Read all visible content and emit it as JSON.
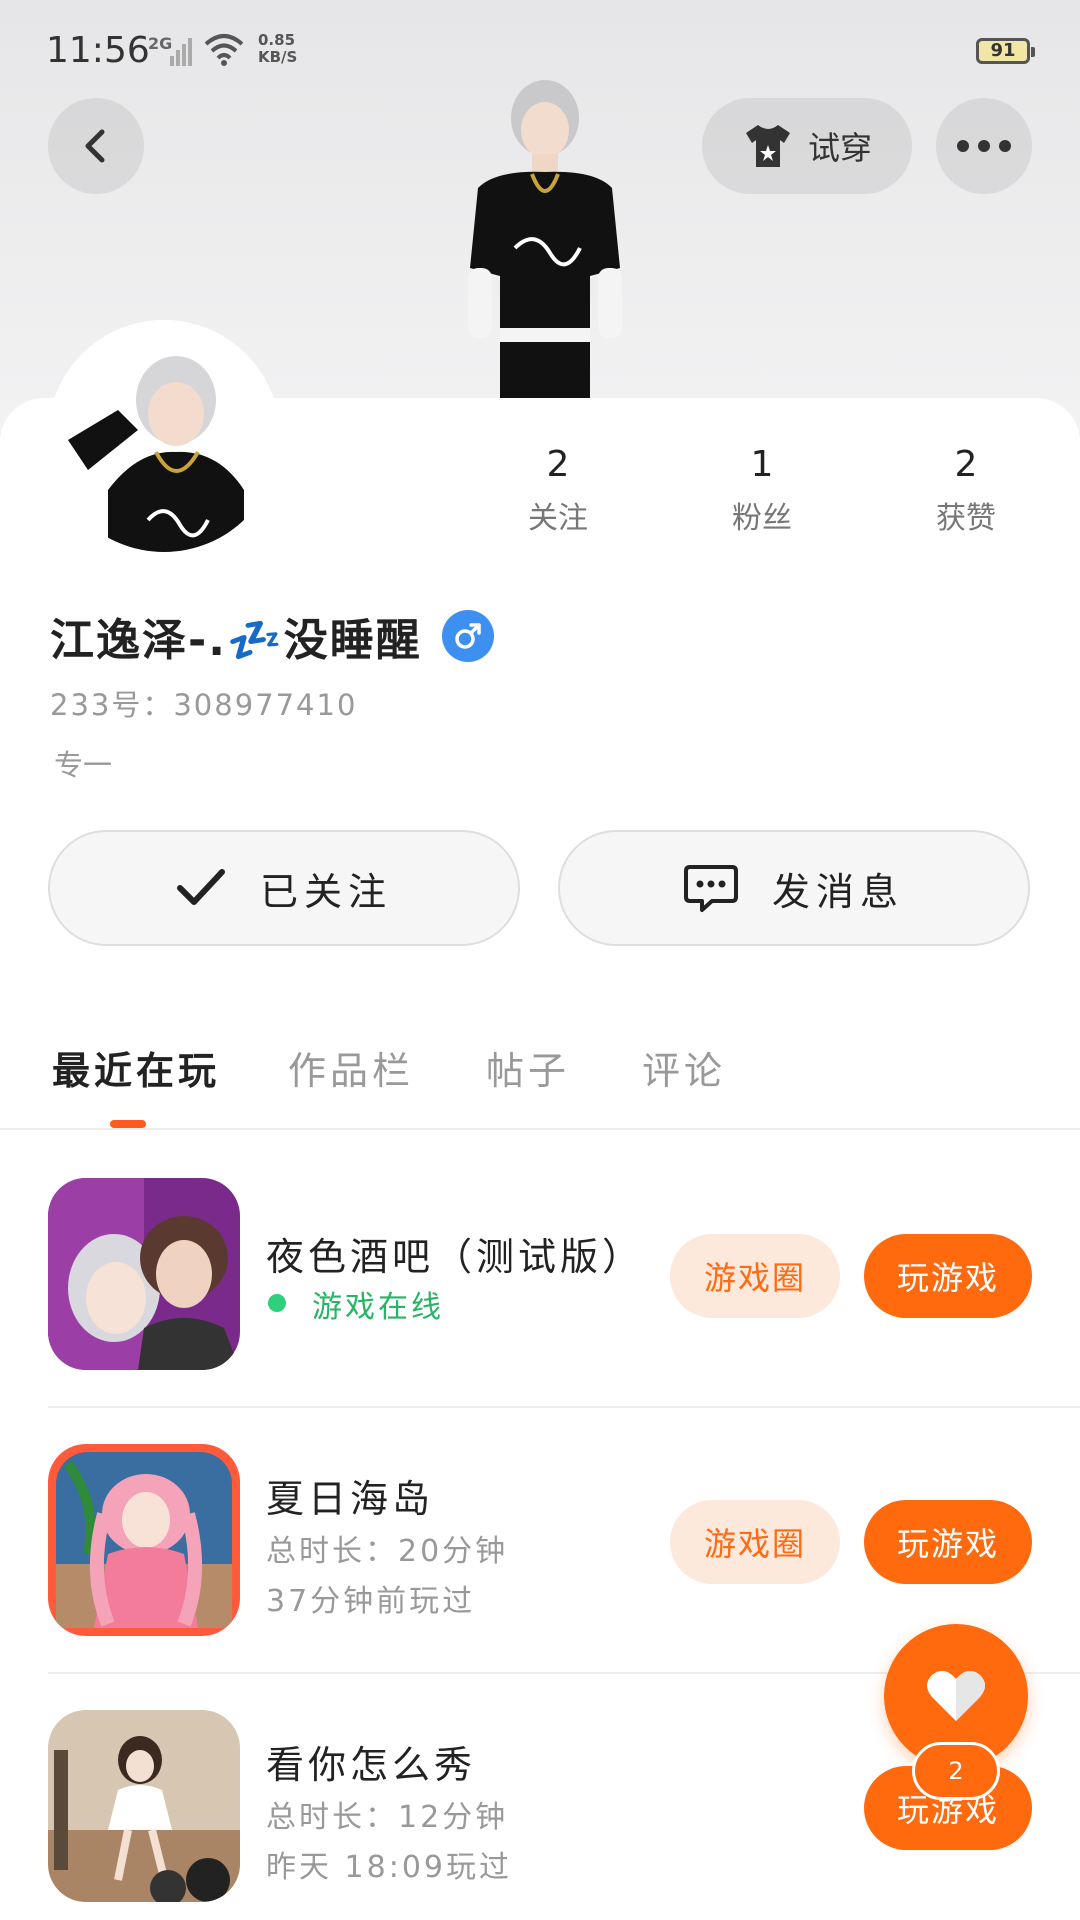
{
  "status_bar": {
    "time": "11:56",
    "network": "2G",
    "speed_value": "0.85",
    "speed_unit": "KB/S",
    "battery": "91"
  },
  "header": {
    "back_icon": "chevron-left-icon",
    "tryon_label": "试穿",
    "tryon_icon": "tshirt-icon",
    "more_icon": "more-dots-icon"
  },
  "profile": {
    "stats": [
      {
        "value": "2",
        "label": "关注"
      },
      {
        "value": "1",
        "label": "粉丝"
      },
      {
        "value": "2",
        "label": "获赞"
      }
    ],
    "name": "江逸泽-.💤没睡醒",
    "gender_icon": "male-icon",
    "uid": "233号：308977410",
    "bio": "专一"
  },
  "actions": {
    "follow_label": "已关注",
    "message_label": "发消息"
  },
  "tabs": [
    {
      "label": "最近在玩",
      "active": true
    },
    {
      "label": "作品栏",
      "active": false
    },
    {
      "label": "帖子",
      "active": false
    },
    {
      "label": "评论",
      "active": false
    }
  ],
  "games": [
    {
      "title": "夜色酒吧（测试版）",
      "status": "游戏在线",
      "circle_label": "游戏圈",
      "play_label": "玩游戏"
    },
    {
      "title": "夏日海岛",
      "duration": "总时长：20分钟",
      "last_played": "37分钟前玩过",
      "circle_label": "游戏圈",
      "play_label": "玩游戏"
    },
    {
      "title": "看你怎么秀",
      "duration": "总时长：12分钟",
      "last_played": "昨天 18:09玩过",
      "play_label": "玩游戏"
    }
  ],
  "fab": {
    "icon": "heart-icon",
    "badge": "2"
  },
  "colors": {
    "accent": "#ff6a0f",
    "accent_soft": "#fde8dc",
    "online": "#26b565",
    "gender": "#3d8ff0"
  }
}
